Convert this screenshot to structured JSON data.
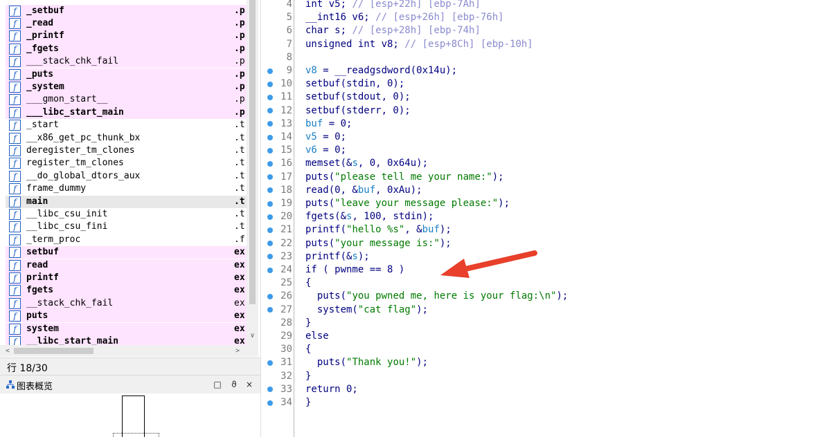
{
  "functions": {
    "rows": [
      {
        "name": "_setbuf",
        "seg": ".p",
        "style": "pink-bold"
      },
      {
        "name": "_read",
        "seg": ".p",
        "style": "pink-bold"
      },
      {
        "name": "_printf",
        "seg": ".p",
        "style": "pink-bold"
      },
      {
        "name": "_fgets",
        "seg": ".p",
        "style": "pink-bold"
      },
      {
        "name": "___stack_chk_fail",
        "seg": ".p",
        "style": "pink"
      },
      {
        "name": "_puts",
        "seg": ".p",
        "style": "pink-bold"
      },
      {
        "name": "_system",
        "seg": ".p",
        "style": "pink-bold"
      },
      {
        "name": "___gmon_start__",
        "seg": ".p",
        "style": "pink"
      },
      {
        "name": "___libc_start_main",
        "seg": ".p",
        "style": "pink-bold"
      },
      {
        "name": "_start",
        "seg": ".t",
        "style": "plain"
      },
      {
        "name": "__x86_get_pc_thunk_bx",
        "seg": ".t",
        "style": "plain"
      },
      {
        "name": "deregister_tm_clones",
        "seg": ".t",
        "style": "plain"
      },
      {
        "name": "register_tm_clones",
        "seg": ".t",
        "style": "plain"
      },
      {
        "name": "__do_global_dtors_aux",
        "seg": ".t",
        "style": "plain"
      },
      {
        "name": "frame_dummy",
        "seg": ".t",
        "style": "plain"
      },
      {
        "name": "main",
        "seg": ".t",
        "style": "selected-bold"
      },
      {
        "name": "__libc_csu_init",
        "seg": ".t",
        "style": "plain"
      },
      {
        "name": "__libc_csu_fini",
        "seg": ".t",
        "style": "plain"
      },
      {
        "name": "_term_proc",
        "seg": ".f",
        "style": "plain"
      },
      {
        "name": "setbuf",
        "seg": "ex",
        "style": "pink-bold"
      },
      {
        "name": "read",
        "seg": "ex",
        "style": "pink-bold"
      },
      {
        "name": "printf",
        "seg": "ex",
        "style": "pink-bold"
      },
      {
        "name": "fgets",
        "seg": "ex",
        "style": "pink-bold"
      },
      {
        "name": "__stack_chk_fail",
        "seg": "ex",
        "style": "pink"
      },
      {
        "name": "puts",
        "seg": "ex",
        "style": "pink-bold"
      },
      {
        "name": "system",
        "seg": "ex",
        "style": "pink-bold"
      },
      {
        "name": "__libc_start_main",
        "seg": "ex",
        "style": "pink-bold"
      }
    ]
  },
  "status": {
    "line": "行 18/30"
  },
  "overview": {
    "title": "图表概览",
    "btn_float": "□",
    "btn_pin": "ϑ",
    "btn_close": "×"
  },
  "code": {
    "lines": [
      {
        "n": "4",
        "bp": false,
        "segs": [
          [
            "k",
            "int v5; "
          ],
          [
            "com",
            "// [esp+22h] [ebp-7Ah]"
          ]
        ]
      },
      {
        "n": "5",
        "bp": false,
        "segs": [
          [
            "k",
            "__int16 v6; "
          ],
          [
            "com",
            "// [esp+26h] [ebp-76h]"
          ]
        ]
      },
      {
        "n": "6",
        "bp": false,
        "segs": [
          [
            "k",
            "char s; "
          ],
          [
            "com",
            "// [esp+28h] [ebp-74h]"
          ]
        ]
      },
      {
        "n": "7",
        "bp": false,
        "segs": [
          [
            "k",
            "unsigned int v8; "
          ],
          [
            "com",
            "// [esp+8Ch] [ebp-10h]"
          ]
        ]
      },
      {
        "n": "8",
        "bp": false,
        "segs": []
      },
      {
        "n": "9",
        "bp": true,
        "segs": [
          [
            "var",
            "v8"
          ],
          [
            "k",
            " = __readgsdword(0x14u);"
          ]
        ]
      },
      {
        "n": "10",
        "bp": true,
        "segs": [
          [
            "k",
            "setbuf(stdin, 0);"
          ]
        ]
      },
      {
        "n": "11",
        "bp": true,
        "segs": [
          [
            "k",
            "setbuf(stdout, 0);"
          ]
        ]
      },
      {
        "n": "12",
        "bp": true,
        "segs": [
          [
            "k",
            "setbuf(stderr, 0);"
          ]
        ]
      },
      {
        "n": "13",
        "bp": true,
        "segs": [
          [
            "var",
            "buf"
          ],
          [
            "k",
            " = 0;"
          ]
        ]
      },
      {
        "n": "14",
        "bp": true,
        "segs": [
          [
            "var",
            "v5"
          ],
          [
            "k",
            " = 0;"
          ]
        ]
      },
      {
        "n": "15",
        "bp": true,
        "segs": [
          [
            "var",
            "v6"
          ],
          [
            "k",
            " = 0;"
          ]
        ]
      },
      {
        "n": "16",
        "bp": true,
        "segs": [
          [
            "k",
            "memset(&"
          ],
          [
            "var",
            "s"
          ],
          [
            "k",
            ", 0, 0x64u);"
          ]
        ]
      },
      {
        "n": "17",
        "bp": true,
        "segs": [
          [
            "k",
            "puts("
          ],
          [
            "str",
            "\"please tell me your name:\""
          ],
          [
            "k",
            ");"
          ]
        ]
      },
      {
        "n": "18",
        "bp": true,
        "segs": [
          [
            "k",
            "read(0, &"
          ],
          [
            "var",
            "buf"
          ],
          [
            "k",
            ", 0xAu);"
          ]
        ]
      },
      {
        "n": "19",
        "bp": true,
        "segs": [
          [
            "k",
            "puts("
          ],
          [
            "str",
            "\"leave your message please:\""
          ],
          [
            "k",
            ");"
          ]
        ]
      },
      {
        "n": "20",
        "bp": true,
        "segs": [
          [
            "k",
            "fgets(&"
          ],
          [
            "var",
            "s"
          ],
          [
            "k",
            ", 100, stdin);"
          ]
        ]
      },
      {
        "n": "21",
        "bp": true,
        "segs": [
          [
            "k",
            "printf("
          ],
          [
            "str",
            "\"hello %s\""
          ],
          [
            "k",
            ", &"
          ],
          [
            "var",
            "buf"
          ],
          [
            "k",
            ");"
          ]
        ]
      },
      {
        "n": "22",
        "bp": true,
        "segs": [
          [
            "k",
            "puts("
          ],
          [
            "str",
            "\"your message is:\""
          ],
          [
            "k",
            ");"
          ]
        ]
      },
      {
        "n": "23",
        "bp": true,
        "segs": [
          [
            "k",
            "printf(&"
          ],
          [
            "var",
            "s"
          ],
          [
            "k",
            ");"
          ]
        ]
      },
      {
        "n": "24",
        "bp": true,
        "segs": [
          [
            "k",
            "if ( pwnme == 8 )"
          ]
        ]
      },
      {
        "n": "25",
        "bp": false,
        "segs": [
          [
            "k",
            "{"
          ]
        ]
      },
      {
        "n": "26",
        "bp": true,
        "segs": [
          [
            "k",
            "  puts("
          ],
          [
            "str",
            "\"you pwned me, here is your flag:\\n\""
          ],
          [
            "k",
            ");"
          ]
        ]
      },
      {
        "n": "27",
        "bp": true,
        "segs": [
          [
            "k",
            "  system("
          ],
          [
            "str",
            "\"cat flag\""
          ],
          [
            "k",
            ");"
          ]
        ]
      },
      {
        "n": "28",
        "bp": false,
        "segs": [
          [
            "k",
            "}"
          ]
        ]
      },
      {
        "n": "29",
        "bp": false,
        "segs": [
          [
            "k",
            "else"
          ]
        ]
      },
      {
        "n": "30",
        "bp": false,
        "segs": [
          [
            "k",
            "{"
          ]
        ]
      },
      {
        "n": "31",
        "bp": true,
        "segs": [
          [
            "k",
            "  puts("
          ],
          [
            "str",
            "\"Thank you!\""
          ],
          [
            "k",
            ");"
          ]
        ]
      },
      {
        "n": "32",
        "bp": false,
        "segs": [
          [
            "k",
            "}"
          ]
        ]
      },
      {
        "n": "33",
        "bp": true,
        "segs": [
          [
            "k",
            "return 0;"
          ]
        ]
      },
      {
        "n": "34",
        "bp": true,
        "segs": [
          [
            "k",
            "}"
          ]
        ]
      }
    ]
  },
  "colors": {
    "import_highlight": "#ffe4ff",
    "selected_row": "#e8e8e8",
    "keyword_text": "#000080",
    "comment_text": "#8a8acf",
    "variable_text": "#1a7fc4",
    "string_text": "#007a00",
    "breakpoint_dot": "#3d9be9",
    "annotation_arrow": "#e8402a"
  },
  "icons": {
    "function": "function-icon",
    "graph_overview": "graph-overview-icon",
    "annotation": "red-arrow"
  }
}
